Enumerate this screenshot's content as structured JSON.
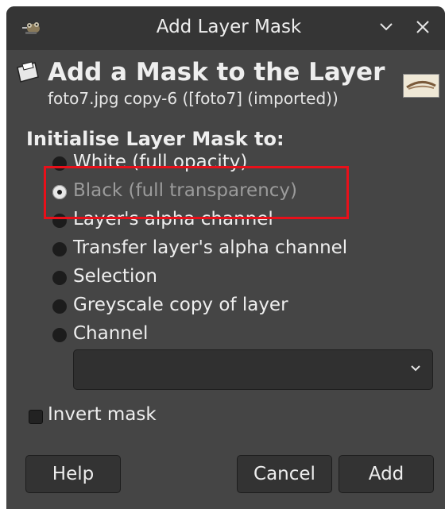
{
  "window": {
    "title": "Add Layer Mask"
  },
  "header": {
    "title": "Add a Mask to the Layer",
    "subtitle": "foto7.jpg copy-6 ([foto7] (imported))"
  },
  "section_label": "Initialise Layer Mask to:",
  "options": [
    {
      "label": "White (full opacity)",
      "checked": false
    },
    {
      "label": "Black (full transparency)",
      "checked": true
    },
    {
      "label": "Layer's alpha channel",
      "checked": false
    },
    {
      "label": "Transfer layer's alpha channel",
      "checked": false
    },
    {
      "label": "Selection",
      "checked": false
    },
    {
      "label": "Greyscale copy of layer",
      "checked": false
    },
    {
      "label": "Channel",
      "checked": false
    }
  ],
  "channel_combo": {
    "value": ""
  },
  "invert_mask": {
    "label": "Invert mask",
    "checked": false
  },
  "buttons": {
    "help": "Help",
    "cancel": "Cancel",
    "add": "Add"
  },
  "colors": {
    "highlight": "#e8101a",
    "background": "#454545"
  }
}
